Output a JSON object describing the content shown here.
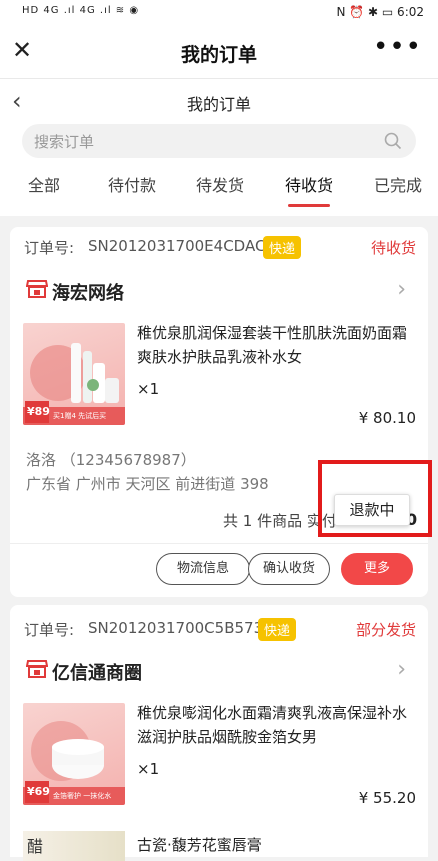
{
  "status_bar": {
    "left": "HD 4G .ıl 4G .ıl ≋ ◉",
    "right": "N ⏰ ✱ ▭ 6:02"
  },
  "app_title": "我的订单",
  "nav_title": "我的订单",
  "search": {
    "placeholder": "搜索订单"
  },
  "tabs": [
    {
      "label": "全部"
    },
    {
      "label": "待付款"
    },
    {
      "label": "待发货"
    },
    {
      "label": "待收货"
    },
    {
      "label": "已完成"
    }
  ],
  "orders": [
    {
      "order_label": "订单号:",
      "order_no": "SN2012031700E4CDAC",
      "badge": "快递",
      "status": "待收货",
      "shop": "海宏网络",
      "product_name": "稚优泉肌润保湿套装干性肌肤洗面奶面霜爽肤水护肤品乳液补水女",
      "qty": "×1",
      "price": "¥ 80.10",
      "thumb_price": "¥89",
      "thumb_caption": "买1赠4 先试后买",
      "contact": "洛洛 （12345678987）",
      "address": "广东省 广州市 天河区 前进街道 398",
      "total_text": "共 1 件商品 实付",
      "total_tail": "0",
      "popup_label": "退款中",
      "buttons": [
        "物流信息",
        "确认收货",
        "更多"
      ]
    },
    {
      "order_label": "订单号:",
      "order_no": "SN2012031700C5B573",
      "badge": "快递",
      "status": "部分发货",
      "shop": "亿信通商圈",
      "product_name": "稚优泉嘭润化水面霜清爽乳液高保湿补水滋润护肤品烟酰胺金箔女男",
      "qty": "×1",
      "price": "¥ 55.20",
      "thumb_price": "¥69",
      "thumb_caption": "金箔奢护 一抹化水",
      "next_product_name": "古瓷·馥芳花蜜唇膏",
      "next_thumb_text": "醋"
    }
  ],
  "colors": {
    "accent": "#e03a3a",
    "badge": "#f6c200",
    "highlight_box": "#e21b1b"
  }
}
